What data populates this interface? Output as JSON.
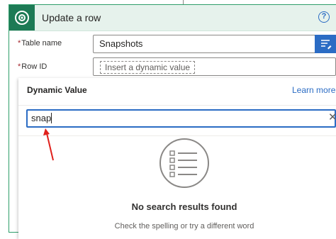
{
  "card": {
    "title": "Update a row",
    "help_symbol": "?",
    "colors": {
      "header_bg": "#e6f2ec",
      "border": "#2e9e6a",
      "logo": "#1d7a55",
      "accent": "#2b6cc4"
    }
  },
  "fields": {
    "table_name": {
      "label": "Table name",
      "value": "Snapshots"
    },
    "row_id": {
      "label": "Row ID",
      "placeholder": "Insert a dynamic value"
    }
  },
  "dynamic_panel": {
    "title": "Dynamic Value",
    "learn_more": "Learn more",
    "search": {
      "value": "snap",
      "clear_symbol": "✕"
    },
    "empty_state": {
      "icon": "list-icon",
      "title": "No search results found",
      "subtitle": "Check the spelling or try a different word"
    }
  },
  "annotation": {
    "icon": "red-arrow-icon",
    "color": "#e0201c"
  }
}
